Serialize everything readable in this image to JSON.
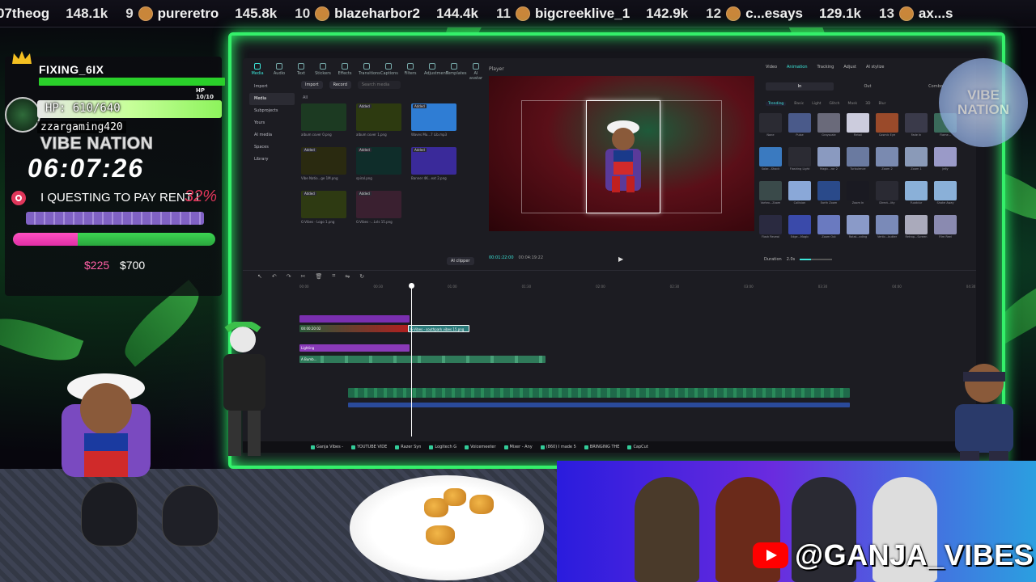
{
  "leaderboard": [
    {
      "rank": "",
      "name": "07theog",
      "score": "148.1k"
    },
    {
      "rank": "9",
      "name": "pureretro",
      "score": "145.8k"
    },
    {
      "rank": "10",
      "name": "blazeharbor2",
      "score": "144.4k"
    },
    {
      "rank": "11",
      "name": "bigcreeklive_1",
      "score": "142.9k"
    },
    {
      "rank": "12",
      "name": "c...esays",
      "score": "129.1k"
    },
    {
      "rank": "13",
      "name": "ax...s",
      "score": ""
    }
  ],
  "overlay": {
    "username": "FIXING_6IX",
    "top_hp_label": "HP 10/10",
    "hp_label": "HP: 610/640",
    "viewer": "zzargaming420",
    "brand": "VIBE NATION",
    "clock": "06:07:26",
    "goal_text": "I QUESTING TO PAY RENT I",
    "goal_percent": "32%",
    "goal_progress": 0.32,
    "goal_current": "$225",
    "goal_target": "$700"
  },
  "editor": {
    "media_tabs": [
      "Media",
      "Audio",
      "Text",
      "Stickers",
      "Effects",
      "Transitions",
      "Captions",
      "Filters",
      "Adjustment",
      "Templates",
      "AI avatar"
    ],
    "sidebar": [
      "Import",
      "Media",
      "Subprojects",
      "Yours",
      "AI media",
      "Spaces",
      "Library"
    ],
    "import_btn": "Import",
    "record_btn": "Record",
    "search_placeholder": "Search media",
    "all_label": "All",
    "media_items": [
      {
        "badge": "",
        "caption": "album cover 0.png",
        "color": "#1c3a22"
      },
      {
        "badge": "Added",
        "caption": "album cover 1.png",
        "color": "#2d3a10"
      },
      {
        "badge": "Added",
        "caption": "Waves Mu...7 Lib.mp3",
        "color": "#2f7dd4"
      },
      {
        "badge": "Added",
        "caption": "Vibe Natio...ge 1M.png",
        "color": "#2a2a10"
      },
      {
        "badge": "Added",
        "caption": "spiral.png",
        "color": "#0f2d2a"
      },
      {
        "badge": "Added",
        "caption": "Banner 4K...ext 2.png",
        "color": "#3a2a9a"
      },
      {
        "badge": "Added",
        "caption": "G-Vibes - Logo 1.png",
        "color": "#2e3a12"
      },
      {
        "badge": "Added",
        "caption": "G-Vibes -...Lvls 15.png",
        "color": "#3a2030"
      }
    ],
    "ai_clipper": "AI clipper",
    "player": {
      "title": "Player",
      "current_time": "00:01:22:00",
      "total_time": "00:04:19:22"
    },
    "effects_tabs": [
      "Video",
      "Animation",
      "Tracking",
      "Adjust",
      "AI stylize"
    ],
    "active_effects_tab": "Animation",
    "inout": [
      "In",
      "Out",
      "Combo"
    ],
    "categories": [
      "Trending",
      "Basic",
      "Light",
      "Glitch",
      "Mask",
      "3D",
      "Blur"
    ],
    "effects": [
      {
        "name": "None",
        "color": "#2b2b33"
      },
      {
        "name": "Pulse",
        "color": "#4a5a8a"
      },
      {
        "name": "Grayscale",
        "color": "#6a6a7a"
      },
      {
        "name": "Retail",
        "color": "#ccd"
      },
      {
        "name": "Cosmic Eye",
        "color": "#9a4a2a"
      },
      {
        "name": "Fade In",
        "color": "#3a3a4a"
      },
      {
        "name": "Flame...",
        "color": "#3a6a5a"
      },
      {
        "name": "Solar...Shock",
        "color": "#3a7ac0"
      },
      {
        "name": "Flashing Light",
        "color": "#2b2b33"
      },
      {
        "name": "Magic...ror 2",
        "color": "#8a9ac0"
      },
      {
        "name": "Turbulence",
        "color": "#6a7aa0"
      },
      {
        "name": "Zoom 2",
        "color": "#7a8ab0"
      },
      {
        "name": "Zoom 1",
        "color": "#8a9ab8"
      },
      {
        "name": "Jelly",
        "color": "#9a9ac8"
      },
      {
        "name": "Vortex...Zoom",
        "color": "#3a4a4a"
      },
      {
        "name": "Collision",
        "color": "#8aa8d8"
      },
      {
        "name": "Earth Zoom",
        "color": "#2a4a8a"
      },
      {
        "name": "Zoom In",
        "color": "#1a1a22"
      },
      {
        "name": "Direct...lity",
        "color": "#2a2a33"
      },
      {
        "name": "Fuzzblur",
        "color": "#8ab0d8"
      },
      {
        "name": "Shake Away",
        "color": "#8ab0d8"
      },
      {
        "name": "Flash Reveal",
        "color": "#2a2a40"
      },
      {
        "name": "Edge...Magic",
        "color": "#3a4aaa"
      },
      {
        "name": "Zoom Out",
        "color": "#6a7ac0"
      },
      {
        "name": "Rotat...ading",
        "color": "#8a9ac8"
      },
      {
        "name": "Vertic...butter",
        "color": "#7a8ab8"
      },
      {
        "name": "Retrop...Screen",
        "color": "#aab"
      },
      {
        "name": "Film Reel",
        "color": "#8a8ab0"
      }
    ],
    "duration_label": "Duration",
    "duration_value": "2.0s",
    "timeline": {
      "ruler": [
        "00:00",
        "00:30",
        "01:00",
        "01:30",
        "02:00",
        "02:30",
        "03:00",
        "03:30",
        "04:00",
        "04:30"
      ],
      "clip_label": "G-Vibes - southpark vibes 15.png",
      "video_time": "00:00:20:02",
      "lighting_label": "Lighting",
      "bumps_label": "A Bumb..."
    }
  },
  "taskbar": [
    "Ganja Vibes -",
    "YOUTUBE VIDE",
    "Razer Syn",
    "Logitech G",
    "Voicemeeter",
    "Mixer - Any",
    "(860) I made 5",
    "BRINGING THE",
    "CapCut"
  ],
  "watermark": {
    "line1": "VIBE",
    "line2": "NATION"
  },
  "social": {
    "handle": "@GANJA_VIBES"
  }
}
